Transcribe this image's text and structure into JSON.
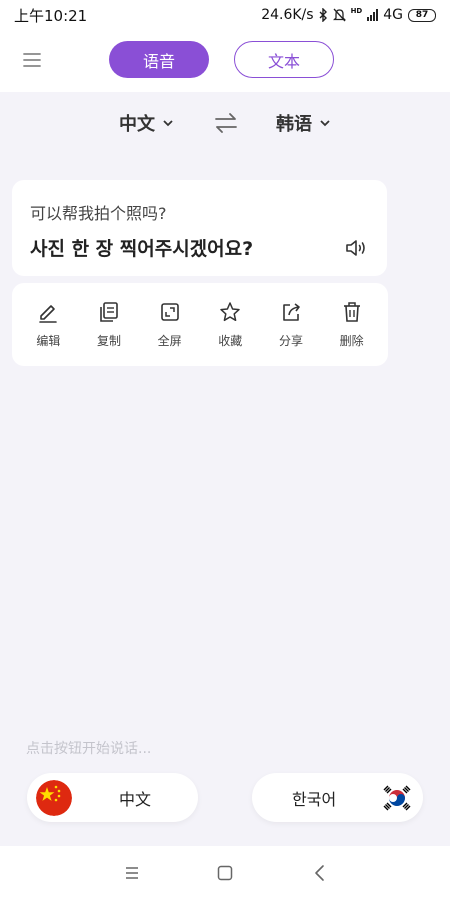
{
  "status_bar": {
    "time": "上午10:21",
    "network_speed": "24.6K/s",
    "hd_label": "HD",
    "network_type": "4G",
    "battery_level": "87"
  },
  "header": {
    "tabs": [
      {
        "label": "语音",
        "active": true
      },
      {
        "label": "文本",
        "active": false
      }
    ]
  },
  "languages": {
    "source": "中文",
    "target": "韩语"
  },
  "translation": {
    "source_text": "可以帮我拍个照吗?",
    "target_text": "사진 한 장 찍어주시겠어요?"
  },
  "actions": [
    {
      "label": "编辑",
      "icon": "pencil-icon"
    },
    {
      "label": "复制",
      "icon": "copy-icon"
    },
    {
      "label": "全屏",
      "icon": "fullscreen-icon"
    },
    {
      "label": "收藏",
      "icon": "star-icon"
    },
    {
      "label": "分享",
      "icon": "share-icon"
    },
    {
      "label": "删除",
      "icon": "trash-icon"
    }
  ],
  "hint": "点击按钮开始说话...",
  "speak_buttons": {
    "chinese": {
      "label": "中文",
      "flag": "china-flag-icon"
    },
    "korean": {
      "label": "한국어",
      "flag": "korea-flag-icon"
    }
  },
  "colors": {
    "accent": "#8a4fd6",
    "background": "#f4f3f9",
    "hint": "#c4c4cc"
  }
}
